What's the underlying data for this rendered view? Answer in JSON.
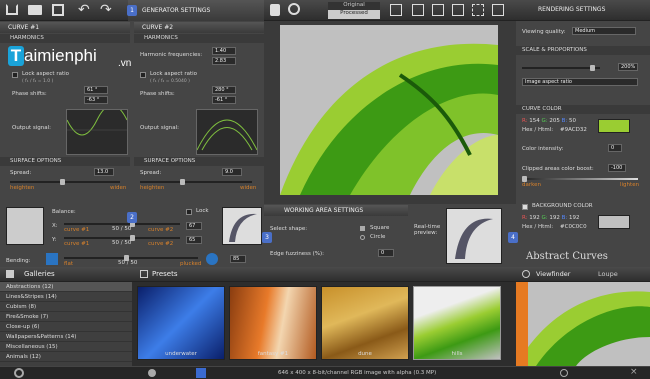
{
  "toolbar": {
    "mode_original": "Original",
    "mode_processed": "Processed"
  },
  "badges": [
    "1",
    "2",
    "3",
    "4"
  ],
  "watermark": {
    "brand": "aimienphi",
    "tld": ".vn"
  },
  "generator": {
    "title": "GENERATOR SETTINGS",
    "curve1": {
      "title": "CURVE #1",
      "section": "HARMONICS",
      "lock": "Lock aspect ratio",
      "lock_hint": "( f₁ / f₂ = 1.0 )",
      "phase": "Phase shifts:",
      "px": "61 °",
      "py": "-63 °",
      "output": "Output signal:"
    },
    "curve2": {
      "title": "CURVE #2",
      "section": "HARMONICS",
      "freq": "Harmonic frequencies:",
      "fx": "1.40",
      "fy": "2.83",
      "lock": "Lock aspect ratio",
      "lock_hint": "( f₁ / f₂ = 0.5040 )",
      "phase": "Phase shifts:",
      "px": "280 °",
      "py": "-61 °",
      "output": "Output signal:"
    },
    "surface1": {
      "section": "SURFACE OPTIONS",
      "spread": "Spread:",
      "spread_val": "13.0",
      "left": "heighten",
      "right": "widen"
    },
    "surface2": {
      "section": "SURFACE OPTIONS",
      "spread": "Spread:",
      "spread_val": "9.0",
      "left": "heighten",
      "right": "widen"
    },
    "balance": {
      "label": "Balance:",
      "lock": "Lock",
      "x_label": "X:",
      "y_label": "Y:",
      "x_left": "curve #1",
      "x_mid": "50 / 50",
      "x_right": "curve #2",
      "x_val": "67",
      "y_left": "curve #1",
      "y_mid": "50 / 50",
      "y_right": "curve #2",
      "y_val": "65"
    },
    "bending": {
      "label": "Bending:",
      "left": "flat",
      "mid": "50 / 50",
      "right": "plucked",
      "val": "85"
    }
  },
  "working_area": {
    "title": "WORKING AREA SETTINGS",
    "shape_label": "Select shape:",
    "opt_square": "Square",
    "opt_circle": "Circle",
    "edge_label": "Edge fuzziness (%):",
    "edge_val": "0",
    "preview_label": "Real-time preview:"
  },
  "rendering": {
    "title": "RENDERING SETTINGS",
    "quality_label": "Viewing quality:",
    "quality_val": "Medium",
    "scale_section": "SCALE & PROPORTIONS",
    "scale_val": "200%",
    "aspect_val": "Image aspect ratio",
    "curve_color_section": "CURVE COLOR",
    "curve_rgb": {
      "r_label": "R:",
      "r": "154",
      "g_label": "G:",
      "g": "205",
      "b_label": "B:",
      "b": "50"
    },
    "curve_hex_label": "Hex / Html:",
    "curve_hex": "#9ACD32",
    "curve_color": "#9ACD32",
    "intensity_label": "Color intensity:",
    "intensity_val": "0",
    "clipped_label": "Clipped areas color boost:",
    "clipped_val": "-100",
    "clipped_left": "darken",
    "clipped_right": "lighten",
    "bg_section": "BACKGROUND COLOR",
    "bg_rgb": {
      "r_label": "R:",
      "r": "192",
      "g_label": "G:",
      "g": "192",
      "b_label": "B:",
      "b": "192"
    },
    "bg_hex_label": "Hex / Html:",
    "bg_hex": "#C0C0C0",
    "bg_color": "#C0C0C0",
    "logo": "Abstract Curves"
  },
  "gallery": {
    "galleries_label": "Galleries",
    "presets_label": "Presets",
    "items": [
      "Abstractions (12)",
      "Lines&Stripes (14)",
      "Cubism (8)",
      "Fire&Smoke (7)",
      "Close-up (6)",
      "Wallpapers&Patterns (14)",
      "Miscellaneous (15)",
      "Animals (12)"
    ],
    "thumbs": [
      "underwater",
      "fantasy #1",
      "dune",
      "hills"
    ]
  },
  "viewfinder": {
    "tab1": "Viewfinder",
    "tab2": "Loupe"
  },
  "status": {
    "text": "646 x 400 x 8-bit/channel RGB image with alpha  (0.3 MP)"
  }
}
